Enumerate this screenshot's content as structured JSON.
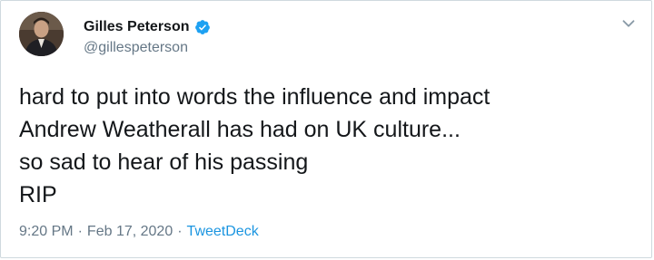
{
  "tweet": {
    "display_name": "Gilles Peterson",
    "handle": "@gillespeterson",
    "lines": [
      "hard to put into words the influence and impact",
      "Andrew Weatherall has had on UK culture...",
      "so sad to hear of his passing",
      "RIP"
    ],
    "time": "9:20 PM",
    "separator": "·",
    "date": "Feb 17, 2020",
    "source": "TweetDeck"
  },
  "icons": {
    "verified": "verified-badge-icon",
    "menu": "chevron-down-icon",
    "avatar": "avatar"
  },
  "colors": {
    "verified": "#1da1f2",
    "link": "#1b95e0",
    "secondary_text": "#657786",
    "primary_text": "#14171a"
  }
}
